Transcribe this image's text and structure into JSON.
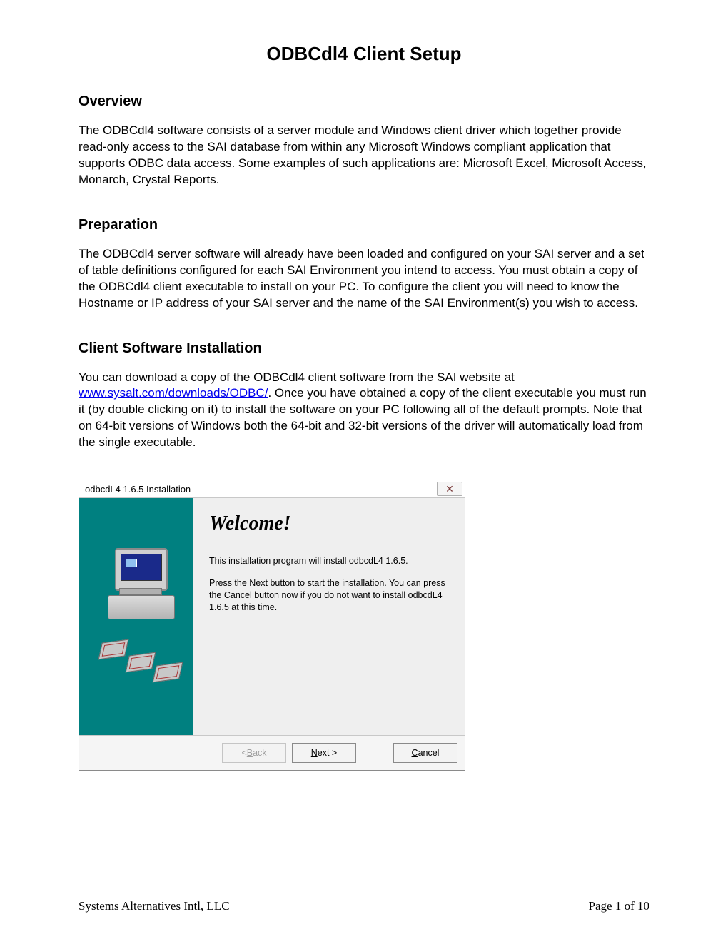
{
  "title": "ODBCdl4 Client Setup",
  "section1_heading": "Overview",
  "section1_body": "The ODBCdl4 software consists of a server module and Windows client driver which together provide read-only access to the SAI database from within any Microsoft Windows compliant application that supports ODBC data access.  Some examples of such applications are:  Microsoft Excel, Microsoft Access, Monarch, Crystal Reports.",
  "section2_heading": "Preparation",
  "section2_body": "The ODBCdl4 server software will already have been loaded and configured on your SAI server and a set of table definitions configured for each SAI Environment you intend to access.  You must obtain a copy of the ODBCdl4 client executable to install on your PC.  To configure the client you will need to know the Hostname or IP address of your SAI server and the name of the SAI Environment(s) you wish to access.",
  "section3_heading": "Client Software Installation",
  "section3_body_pre": "You can download a copy of the ODBCdl4 client software from the SAI website at ",
  "section3_link": "www.sysalt.com/downloads/ODBC/",
  "section3_body_post": ".  Once you have obtained a copy of the client executable you must run it (by double clicking on it) to install the software on your PC following all of the default prompts.  Note that on 64-bit versions of Windows both the 64-bit and 32-bit versions of the driver will automatically load from the single executable.",
  "installer": {
    "title": "odbcdL4 1.6.5 Installation",
    "welcome": "Welcome!",
    "line1": "This installation program will install odbcdL4 1.6.5.",
    "line2": "Press the Next button to start the installation. You can press the Cancel button now if you do not want to install odbcdL4 1.6.5 at this time.",
    "back": "< Back",
    "next": "Next >",
    "cancel": "Cancel"
  },
  "footer_left": "Systems Alternatives Intl, LLC",
  "footer_right": "Page 1 of 10"
}
